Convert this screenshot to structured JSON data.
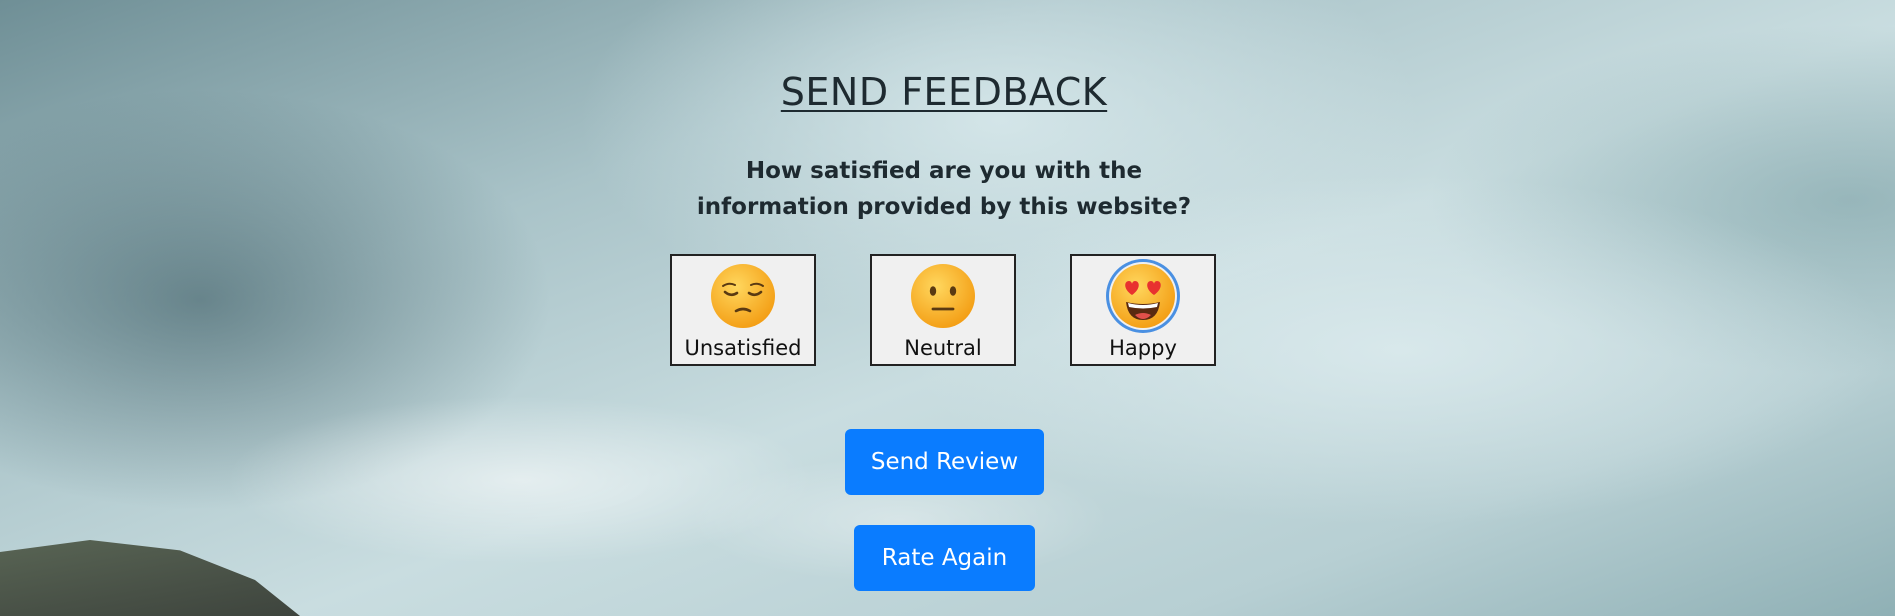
{
  "page": {
    "title": "SEND FEEDBACK",
    "question_line1": "How satisfied are you with the",
    "question_line2": "information provided by this website?"
  },
  "options": [
    {
      "label": "Unsatisfied",
      "icon": "pensive-face-icon",
      "selected": false
    },
    {
      "label": "Neutral",
      "icon": "neutral-face-icon",
      "selected": false
    },
    {
      "label": "Happy",
      "icon": "heart-eyes-face-icon",
      "selected": true
    }
  ],
  "buttons": {
    "send_review": "Send Review",
    "rate_again": "Rate Again"
  },
  "colors": {
    "button_bg": "#0a7cff",
    "button_text": "#ffffff",
    "selected_ring": "#4a90e2",
    "option_bg": "#f0f0f0",
    "emoji_yellow": "#f7b52b"
  }
}
